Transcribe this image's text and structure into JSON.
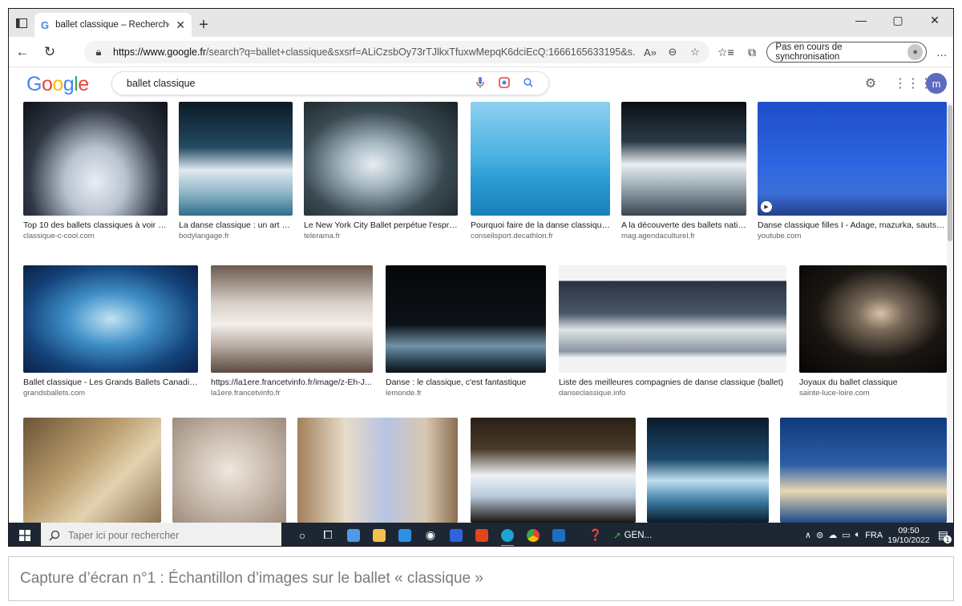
{
  "browser": {
    "tab_title": "ballet classique – Recherche Goo",
    "url_host": "https://www.google.fr",
    "url_rest": "/search?q=ballet+classique&sxsrf=ALiCzsbOy73rTJlkxTfuxwMepqK6dciEcQ:1666165633195&s...",
    "sync_label": "Pas en cours de synchronisation"
  },
  "google": {
    "logo": "Google",
    "query": "ballet classique",
    "avatar_letter": "m"
  },
  "results": {
    "row1": [
      {
        "caption": "Top 10 des ballets classiques à voir a...",
        "source": "classique-c-cool.com"
      },
      {
        "caption": "La danse classique : un art q...",
        "source": "bodylangage.fr"
      },
      {
        "caption": "Le New York City Ballet perpétue l'esprit ...",
        "source": "telerama.fr"
      },
      {
        "caption": "Pourquoi faire de la danse classique ?",
        "source": "conseilsport.decathlon.fr"
      },
      {
        "caption": "A la découverte des ballets natio...",
        "source": "mag.agendaculturel.fr"
      },
      {
        "caption": "Danse classique filles I - Adage, mazurka, sauts, fo...",
        "source": "youtube.com"
      }
    ],
    "row2": [
      {
        "caption": "Ballet classique - Les Grands Ballets Canadiens",
        "source": "grandsballets.com"
      },
      {
        "caption": "https://la1ere.francetvinfo.fr/image/z-Eh-J...",
        "source": "la1ere.francetvinfo.fr"
      },
      {
        "caption": "Danse : le classique, c'est fantastique",
        "source": "lemonde.fr"
      },
      {
        "caption": "Liste des meilleures compagnies de danse classique (ballet)",
        "source": "danseclassique.info"
      },
      {
        "caption": "Joyaux du ballet classique",
        "source": "sainte-luce-loire.com"
      }
    ]
  },
  "taskbar": {
    "search_placeholder": "Taper ici pour rechercher",
    "gen_label": "GEN...",
    "lang": "FRA",
    "time": "09:50",
    "date": "19/10/2022",
    "notif_count": "1"
  },
  "caption_text": "Capture d’écran n°1 : Échantillon d’images sur le ballet « classique »",
  "colors": {
    "google_blue": "#4285F4",
    "google_red": "#EA4335",
    "google_yellow": "#FBBC05",
    "google_green": "#34A853",
    "taskbar": "#1d2733"
  }
}
